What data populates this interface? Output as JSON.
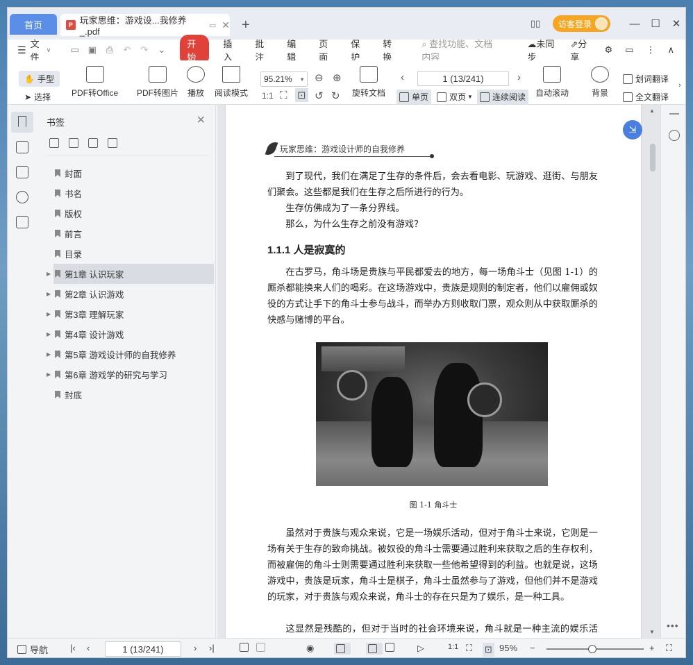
{
  "titlebar": {
    "home_tab": "首页",
    "doc_tab": "玩家思维：游戏设...我修养_.pdf",
    "login": "访客登录"
  },
  "menu": {
    "file": "文件",
    "start": "开始",
    "items": [
      "插入",
      "批注",
      "编辑",
      "页面",
      "保护",
      "转换"
    ],
    "search_placeholder": "查找功能、文档内容",
    "sync": "未同步",
    "share": "分享"
  },
  "toolbar": {
    "hand": "手型",
    "select": "选择",
    "pdf_to_office": "PDF转Office",
    "pdf_to_image": "PDF转图片",
    "play": "播放",
    "read_mode": "阅读模式",
    "zoom": "95.21%",
    "rotate_doc": "旋转文档",
    "page_indicator": "1 (13/241)",
    "single_page": "单页",
    "double_page": "双页",
    "continuous": "连续阅读",
    "auto_scroll": "自动滚动",
    "background": "背景",
    "word_translate": "划词翻译",
    "full_translate": "全文翻译"
  },
  "bookmarks": {
    "title": "书签",
    "items": [
      {
        "label": "封面",
        "expandable": false
      },
      {
        "label": "书名",
        "expandable": false
      },
      {
        "label": "版权",
        "expandable": false
      },
      {
        "label": "前言",
        "expandable": false
      },
      {
        "label": "目录",
        "expandable": false
      },
      {
        "label": "第1章  认识玩家",
        "expandable": true,
        "selected": true
      },
      {
        "label": "第2章  认识游戏",
        "expandable": true
      },
      {
        "label": "第3章  理解玩家",
        "expandable": true
      },
      {
        "label": "第4章  设计游戏",
        "expandable": true
      },
      {
        "label": "第5章  游戏设计师的自我修养",
        "expandable": true
      },
      {
        "label": "第6章  游戏学的研究与学习",
        "expandable": true
      },
      {
        "label": "封底",
        "expandable": false
      }
    ]
  },
  "page": {
    "header": "玩家思维：游戏设计师的自我修养",
    "p1": "到了现代，我们在满足了生存的条件后，会去看电影、玩游戏、逛街、与朋友们聚会。这些都是我们在生存之后所进行的行为。",
    "p2": "生存仿佛成为了一条分界线。",
    "p3": "那么，为什么生存之前没有游戏？",
    "section": "1.1.1   人是寂寞的",
    "p4": "在古罗马，角斗场是贵族与平民都爱去的地方，每一场角斗士（见图 1-1）的厮杀都能换来人们的喝彩。在这场游戏中，贵族是规则的制定者，他们以雇佣或奴役的方式让手下的角斗士参与战斗，而举办方则收取门票，观众则从中获取厮杀的快感与赌博的平台。",
    "caption": "图 1-1    角斗士",
    "p5": "虽然对于贵族与观众来说，它是一场娱乐活动，但对于角斗士来说，它则是一场有关于生存的致命挑战。被奴役的角斗士需要通过胜利来获取之后的生存权利，而被雇佣的角斗士则需要通过胜利来获取一些他希望得到的利益。也就是说，这场游戏中，贵族是玩家，角斗士是棋子，角斗士虽然参与了游戏，但他们并不是游戏的玩家，对于贵族与观众来说，角斗士的存在只是为了娱乐，是一种工具。",
    "p6": "这显然是残酷的，但对于当时的社会环境来说，角斗就是一种主流的娱乐活动。角斗是一种游戏规则，角斗场则是这种游戏规则所需要的平台，它承载着"
  },
  "statusbar": {
    "nav": "导航",
    "page": "1 (13/241)",
    "zoom": "95%"
  }
}
